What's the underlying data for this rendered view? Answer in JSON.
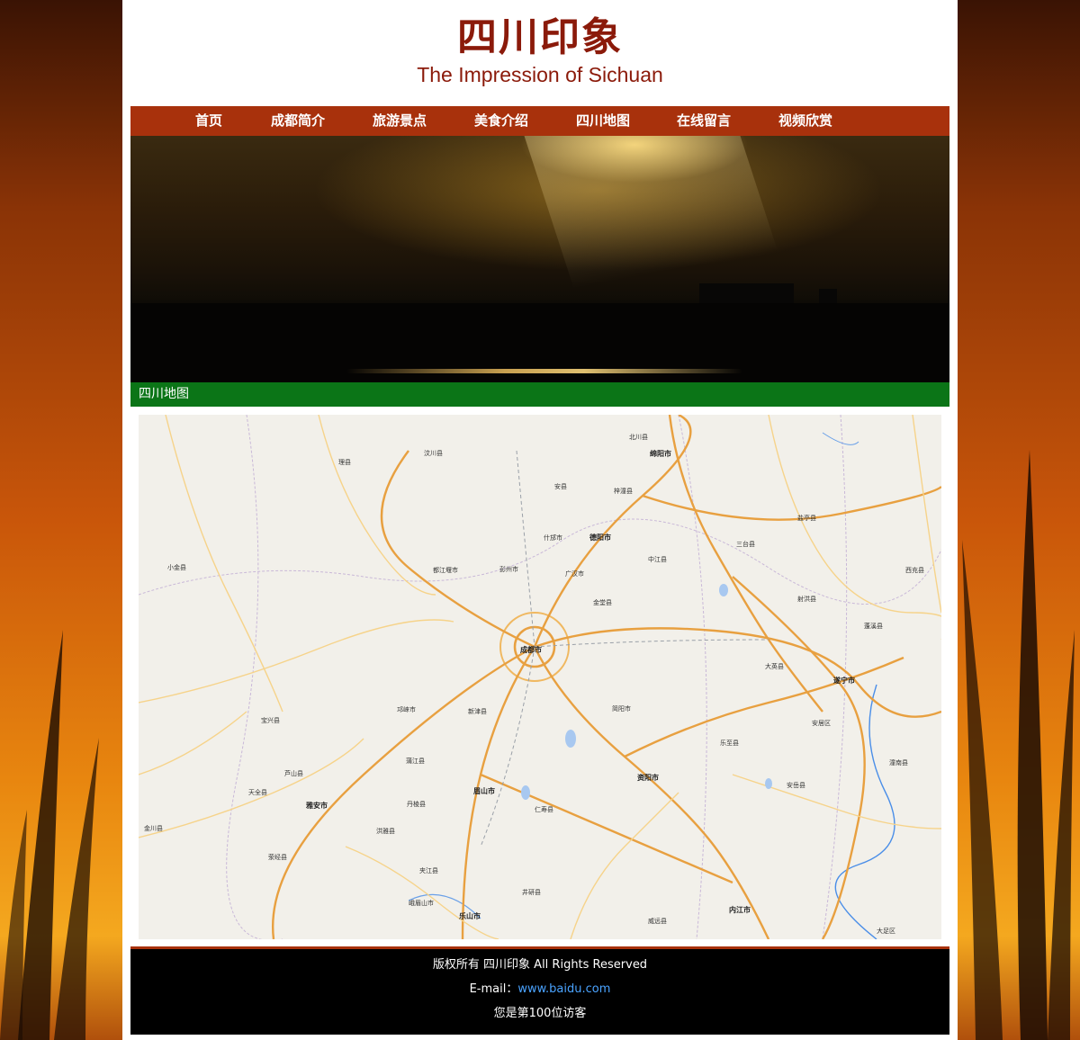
{
  "header": {
    "title": "四川印象",
    "subtitle": "The Impression of Sichuan"
  },
  "nav": {
    "items": [
      {
        "label": "首页"
      },
      {
        "label": "成都简介"
      },
      {
        "label": "旅游景点"
      },
      {
        "label": "美食介绍"
      },
      {
        "label": "四川地图"
      },
      {
        "label": "在线留言"
      },
      {
        "label": "视频欣赏"
      }
    ]
  },
  "section": {
    "title": "四川地图"
  },
  "map": {
    "labels": [
      "成都市",
      "德阳市",
      "绵阳市",
      "遂宁市",
      "资阳市",
      "乐山市",
      "眉山市",
      "雅安市",
      "内江市",
      "安岳县",
      "仁寿县",
      "简阳市",
      "都江堰市",
      "彭州市",
      "新津县",
      "邛崃市",
      "蒲江县",
      "丹棱县",
      "洪雅县",
      "夹江县",
      "峨眉山市",
      "井研县",
      "威远县",
      "大足区",
      "潼南县",
      "射洪县",
      "三台县",
      "盐亭县",
      "梓潼县",
      "安县",
      "北川县",
      "什邡市",
      "广汉市",
      "中江县",
      "金堂县",
      "大英县",
      "乐至县",
      "安居区",
      "小金县",
      "汶川县",
      "理县",
      "宝兴县",
      "芦山县",
      "天全县",
      "荥经县",
      "金川县",
      "西充县",
      "蓬溪县"
    ]
  },
  "footer": {
    "copyright": "版权所有 四川印象 All Rights Reserved",
    "email_label": "E-mail：",
    "email_link": "www.baidu.com",
    "visitors": "您是第100位访客"
  }
}
